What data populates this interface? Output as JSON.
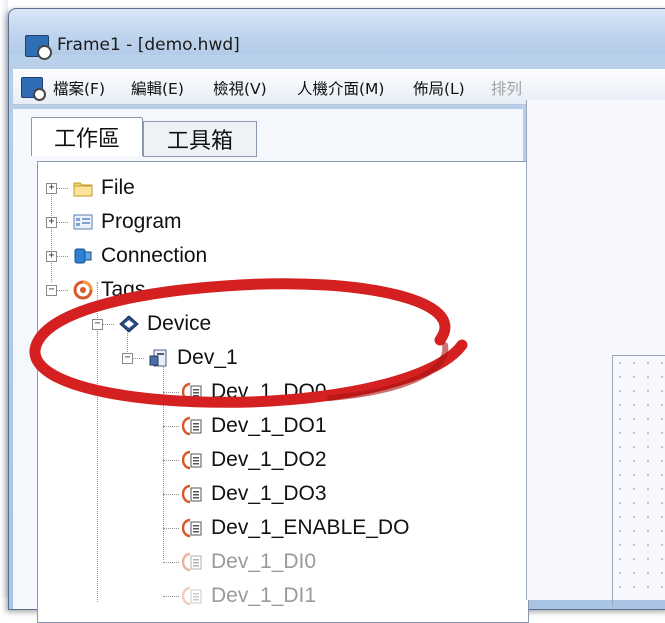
{
  "window": {
    "title": "Frame1 - [demo.hwd]"
  },
  "menubar": {
    "items": [
      "檔案(F)",
      "編輯(E)",
      "檢視(V)",
      "人機介面(M)",
      "佈局(L)",
      "排列"
    ]
  },
  "tabs": [
    "工作區",
    "工具箱"
  ],
  "tree": {
    "nodes": [
      {
        "label": "File",
        "icon": "folder-icon"
      },
      {
        "label": "Program",
        "icon": "program-icon"
      },
      {
        "label": "Connection",
        "icon": "connection-icon"
      },
      {
        "label": "Tags",
        "icon": "tags-icon"
      },
      {
        "label": "Device",
        "icon": "device-icon"
      },
      {
        "label": "Dev_1",
        "icon": "dev-icon"
      },
      {
        "label": "Dev_1_DO0",
        "icon": "tag-item-icon"
      },
      {
        "label": "Dev_1_DO1",
        "icon": "tag-item-icon"
      },
      {
        "label": "Dev_1_DO2",
        "icon": "tag-item-icon"
      },
      {
        "label": "Dev_1_DO3",
        "icon": "tag-item-icon"
      },
      {
        "label": "Dev_1_ENABLE_DO",
        "icon": "tag-item-icon"
      },
      {
        "label": "Dev_1_DI0",
        "icon": "tag-item-icon"
      },
      {
        "label": "Dev_1_DI1",
        "icon": "tag-item-icon"
      }
    ]
  },
  "colors": {
    "highlight_ellipse": "#d42020",
    "accent": "#2f6db5"
  }
}
